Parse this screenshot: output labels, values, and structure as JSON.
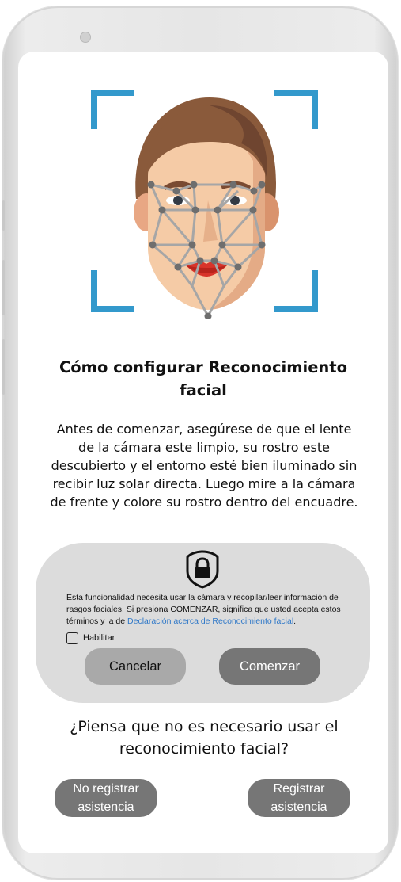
{
  "screen": {
    "title": "Cómo configurar Reconocimiento facial",
    "instructions": "Antes de comenzar, asegúrese de que el lente de la cámara este limpio, su rostro este descubierto y el entorno esté bien iluminado sin recibir luz solar directa. Luego mire a la cámara de frente y colore su rostro dentro del encuadre."
  },
  "consent": {
    "text_before": "Esta funcionalidad necesita usar la cámara y recopilar/leer información de rasgos faciales. Si presiona COMENZAR, significa que usted acepta estos términos y la de ",
    "link_text": "Declaración acerca de Reconocimiento facial",
    "text_after": ".",
    "checkbox_label": "Habilitar",
    "checkbox_checked": false,
    "cancel_label": "Cancelar",
    "start_label": "Comenzar"
  },
  "alternative": {
    "question": "¿Piensa que no es necesario usar el reconocimiento facial?",
    "no_register_label": "No registrar asistencia",
    "register_label": "Registrar asistencia"
  },
  "icons": {
    "face": "face-scan-icon",
    "lock": "shield-lock-icon"
  },
  "colors": {
    "frame_accent": "#3399cc",
    "card_bg": "#dcdcdc",
    "button_dark": "#767676",
    "button_light": "#a9a9a9",
    "link": "#2f78c8"
  }
}
